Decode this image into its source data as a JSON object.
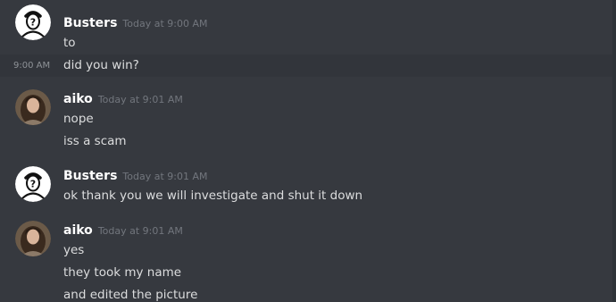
{
  "messages": [
    {
      "author": "Busters",
      "timestamp": "Today at 9:00 AM",
      "avatar": "anonymous-user-icon",
      "lines": [
        {
          "text": "to"
        },
        {
          "text": "did you win?",
          "hover_time": "9:00 AM"
        }
      ]
    },
    {
      "author": "aiko",
      "timestamp": "Today at 9:01 AM",
      "avatar": "user-photo-avatar",
      "lines": [
        {
          "text": "nope"
        },
        {
          "text": "iss a scam"
        }
      ]
    },
    {
      "author": "Busters",
      "timestamp": "Today at 9:01 AM",
      "avatar": "anonymous-user-icon",
      "lines": [
        {
          "text": "ok thank you we will investigate and shut it down"
        }
      ]
    },
    {
      "author": "aiko",
      "timestamp": "Today at 9:01 AM",
      "avatar": "user-photo-avatar",
      "lines": [
        {
          "text": "yes"
        },
        {
          "text": "they took my name"
        },
        {
          "text": "and edited the picture"
        }
      ]
    }
  ],
  "colors": {
    "background": "#36393f",
    "hover_row": "#32353b",
    "author": "#ffffff",
    "message_text": "#dcddde",
    "timestamp": "#72767d"
  }
}
